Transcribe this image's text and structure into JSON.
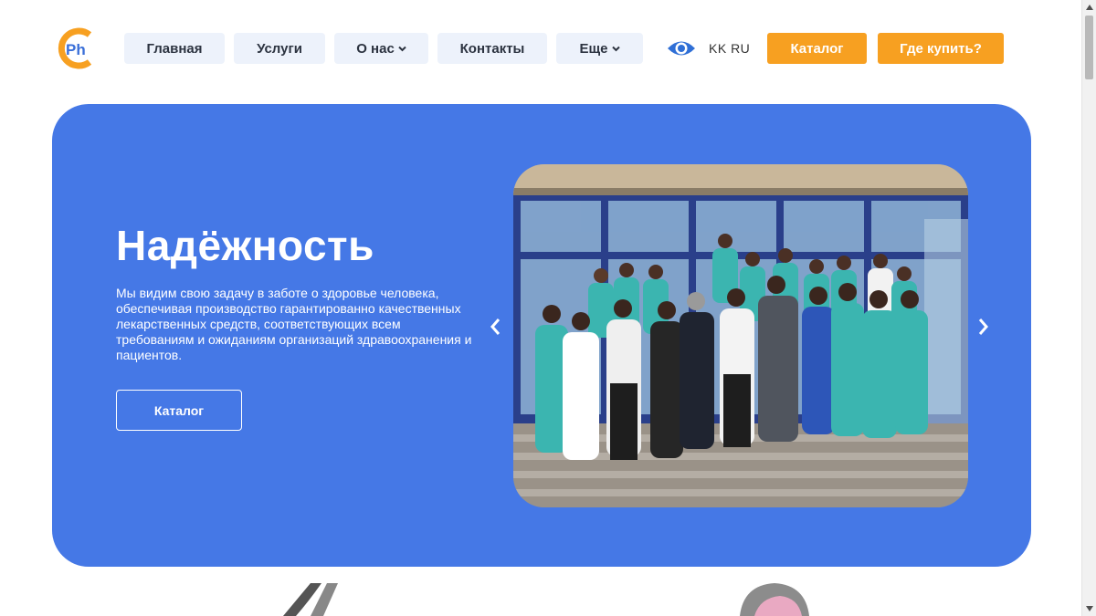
{
  "header": {
    "logo_text": "Ph",
    "nav": [
      {
        "label": "Главная",
        "has_dropdown": false
      },
      {
        "label": "Услуги",
        "has_dropdown": false
      },
      {
        "label": "О нас",
        "has_dropdown": true
      },
      {
        "label": "Контакты",
        "has_dropdown": false
      },
      {
        "label": "Еще",
        "has_dropdown": true
      }
    ],
    "accessibility_icon": "eye-icon",
    "languages": "KK RU",
    "catalog_button": "Каталог",
    "where_to_buy_button": "Где купить?"
  },
  "hero": {
    "title": "Надёжность",
    "text": "Мы видим свою задачу в заботе о здоровье человека, обеспечивая производство гарантированно качественных лекарственных средств, соответствующих всем требованиям и ожиданиям организаций здравоохранения и пациентов.",
    "button": "Каталог",
    "prev_icon": "chevron-left-icon",
    "next_icon": "chevron-right-icon",
    "photo_alt": "staff-group-photo"
  },
  "colors": {
    "accent_blue": "#4578e6",
    "accent_orange": "#f7a021",
    "nav_bg": "#edf2fb"
  }
}
